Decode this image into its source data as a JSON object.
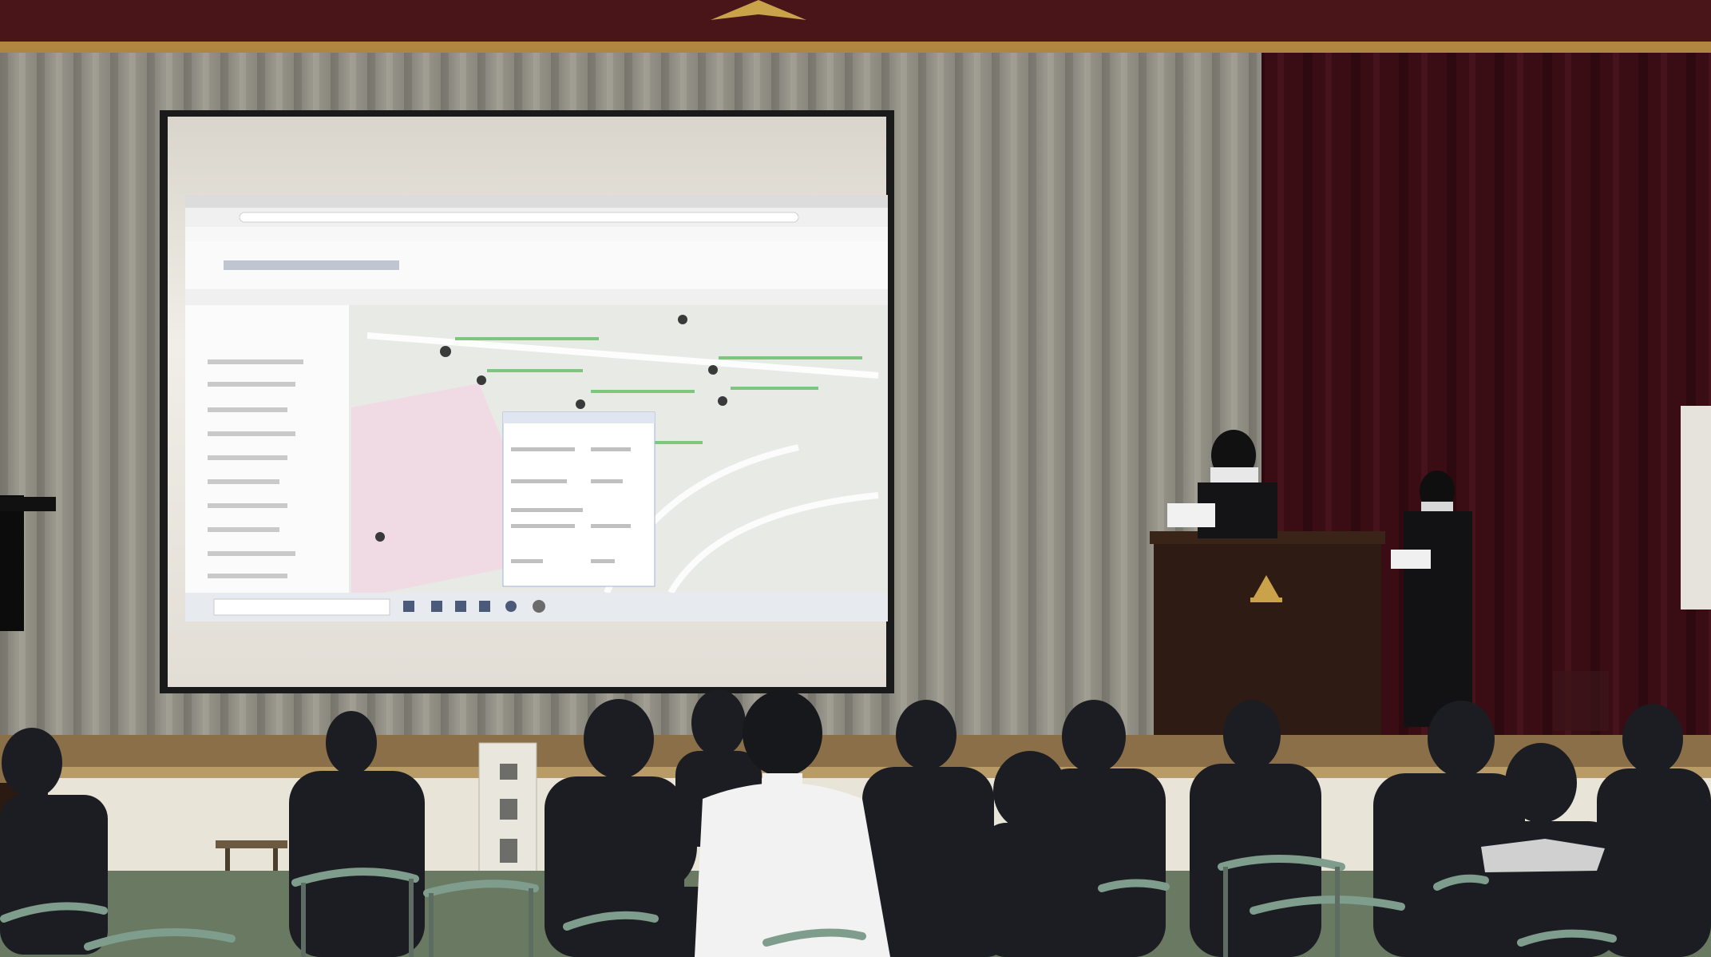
{
  "scene": {
    "description_free": true,
    "colors": {
      "curtain_grey": "#8f8d84",
      "curtain_dark": "#3a0d14",
      "valance": "#4a1518",
      "stage_floor": "#c9b48c",
      "screen": "#f0ede6",
      "map_bg": "#e9ebe6",
      "browser_bar": "#f3f3f3",
      "podium": "#2e1b14",
      "chair_green": "#7f9d8c",
      "uniform_dark": "#1c1d22",
      "shirt_white": "#f2f2f2"
    }
  }
}
